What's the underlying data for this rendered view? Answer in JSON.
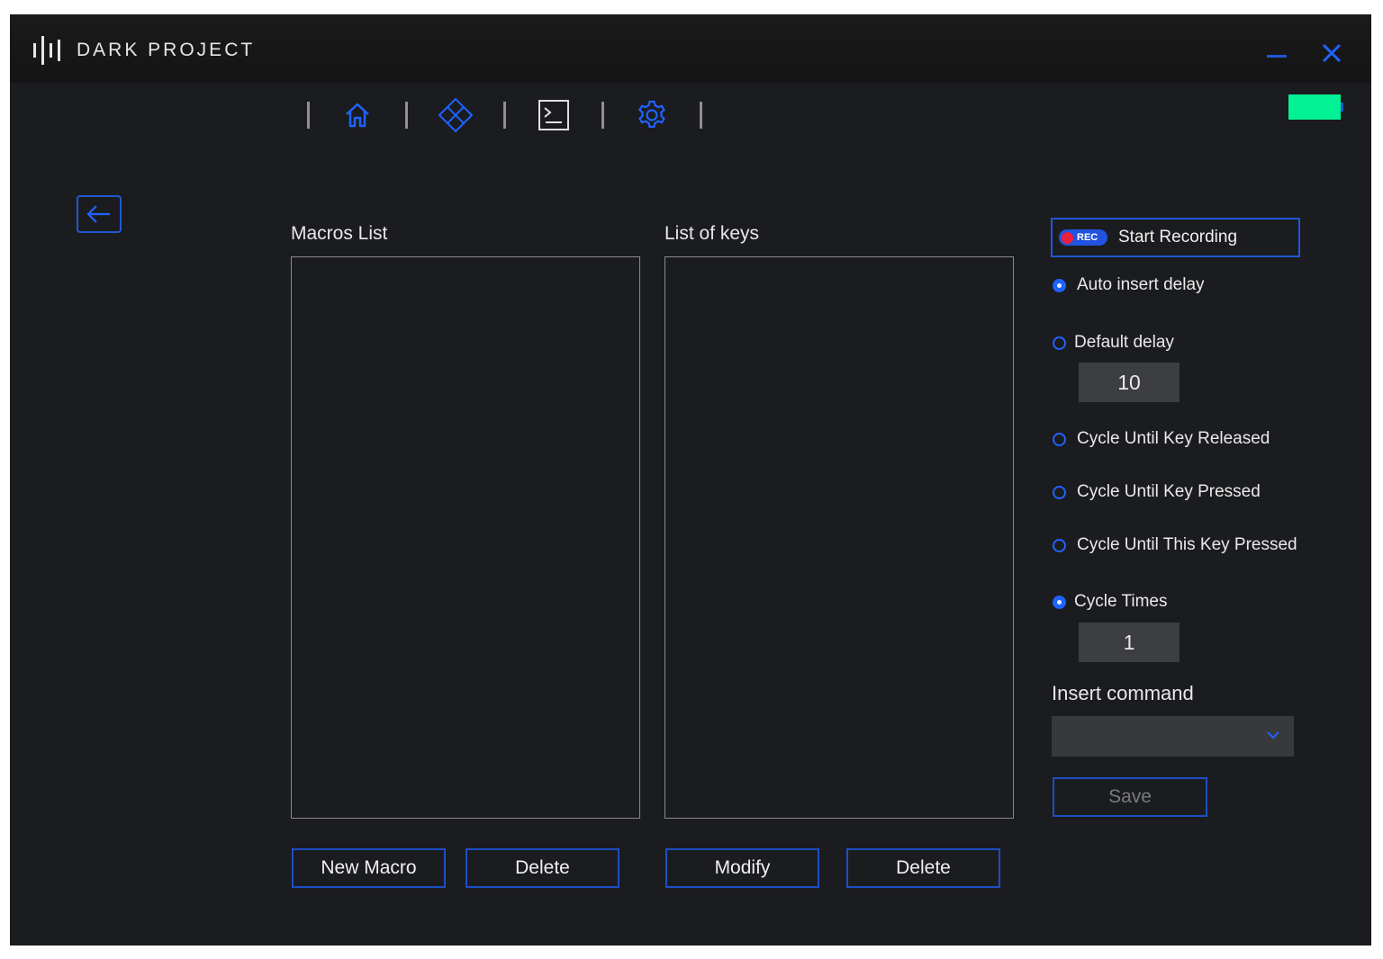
{
  "app": {
    "brand": "DARK PROJECT",
    "accent_color": "#1f58d6",
    "battery_color": "#00f295"
  },
  "window_controls": {
    "minimize_icon": "minimize-icon",
    "close_icon": "close-icon"
  },
  "nav": {
    "items": [
      {
        "icon": "home-icon"
      },
      {
        "icon": "diamond-keys-icon"
      },
      {
        "icon": "terminal-icon"
      },
      {
        "icon": "gear-icon"
      }
    ]
  },
  "macros": {
    "label": "Macros List",
    "new_button": "New Macro",
    "delete_button": "Delete"
  },
  "keys": {
    "label": "List of keys",
    "modify_button": "Modify",
    "delete_button": "Delete"
  },
  "recording": {
    "badge": "REC",
    "label": "Start Recording"
  },
  "options": {
    "auto_insert_delay": "Auto insert delay",
    "default_delay": "Default delay",
    "default_delay_value": "10",
    "cycle_until_key_released": "Cycle Until Key Released",
    "cycle_until_key_pressed": "Cycle Until Key Pressed",
    "cycle_until_this_key_pressed": "Cycle Until This Key Pressed",
    "cycle_times": "Cycle Times",
    "cycle_times_value": "1"
  },
  "insert_command": {
    "label": "Insert command",
    "selected": ""
  },
  "save_button": "Save"
}
